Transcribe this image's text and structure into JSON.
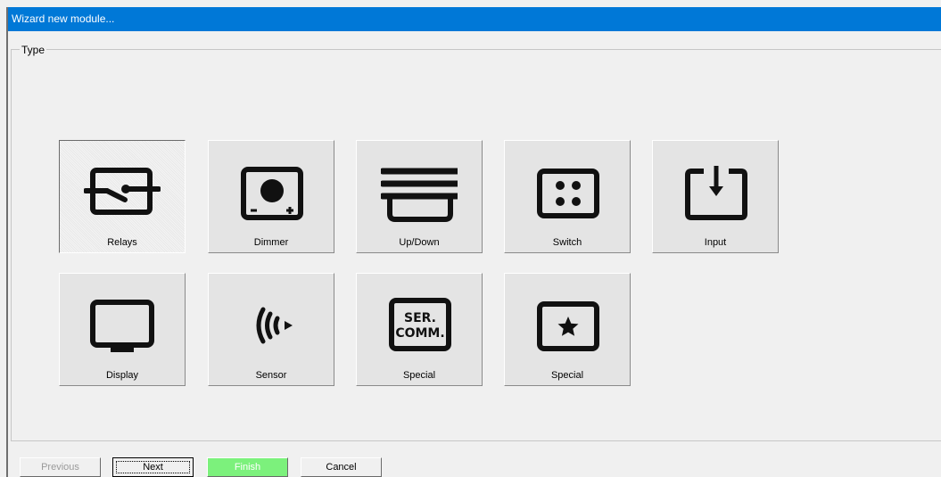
{
  "window": {
    "title": "Wizard new module..."
  },
  "group": {
    "label": "Type"
  },
  "tiles": [
    {
      "label": "Relays",
      "icon": "relay-icon",
      "selected": true
    },
    {
      "label": "Dimmer",
      "icon": "dimmer-icon"
    },
    {
      "label": "Up/Down",
      "icon": "up-down-icon"
    },
    {
      "label": "Switch",
      "icon": "switch-icon"
    },
    {
      "label": "Input",
      "icon": "input-icon"
    },
    {
      "label": "Display",
      "icon": "display-icon"
    },
    {
      "label": "Sensor",
      "icon": "sensor-icon"
    },
    {
      "label": "Special",
      "icon": "serial-comm-icon",
      "icon_text": [
        "SER.",
        "COMM."
      ]
    },
    {
      "label": "Special",
      "icon": "star-icon"
    }
  ],
  "buttons": {
    "previous": "Previous",
    "next": "Next",
    "finish": "Finish",
    "cancel": "Cancel"
  },
  "colors": {
    "titlebar": "#0078d7",
    "finish_button": "#7cf17c",
    "icon": "#111111"
  }
}
